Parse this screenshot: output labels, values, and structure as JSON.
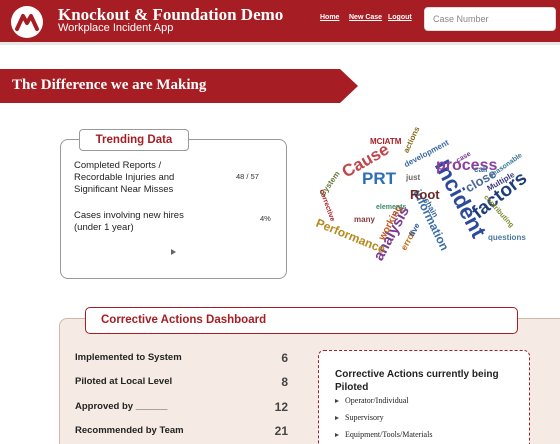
{
  "header": {
    "title": "Knockout & Foundation Demo",
    "subtitle": "Workplace Incident App",
    "nav": {
      "home": "Home",
      "new_case": "New Case",
      "logout": "Logout"
    },
    "search_placeholder": "Case Number",
    "brand_color": "#a61e23"
  },
  "banner": {
    "text": "The Difference we are Making"
  },
  "trending": {
    "title": "Trending Data",
    "rows": [
      {
        "label_lines": [
          "Completed Reports /",
          "Recordable Injuries and",
          "Significant Near Misses"
        ],
        "value": "48 / 57"
      },
      {
        "label_lines": [
          "Cases involving new hires",
          "(under 1 year)"
        ],
        "value": "4%"
      }
    ],
    "play_icon": "play-icon"
  },
  "word_cloud": {
    "words": [
      "Incident",
      "factors",
      "process",
      "PRT",
      "Cause",
      "analysis",
      "information",
      "Performance",
      "Root",
      "close",
      "MCIATM",
      "development",
      "actions",
      "reasonable",
      "contributing",
      "questions",
      "System",
      "corrective",
      "many",
      "working",
      "elements",
      "error",
      "five",
      "Multiple",
      "case",
      "call",
      "just",
      "chain"
    ]
  },
  "corrective": {
    "title": "Corrective Actions Dashboard",
    "stats": [
      {
        "label": "Implemented to System",
        "value": "6"
      },
      {
        "label": "Piloted at Local Level",
        "value": "8"
      },
      {
        "label": "Approved by ______",
        "value": "12"
      },
      {
        "label": "Recommended by Team",
        "value": "21"
      }
    ],
    "piloted": {
      "title": "Corrective Actions currently being Piloted",
      "items": [
        "Operator/Individual",
        "Supervisory",
        "Equipment/Tools/Materials"
      ]
    }
  }
}
